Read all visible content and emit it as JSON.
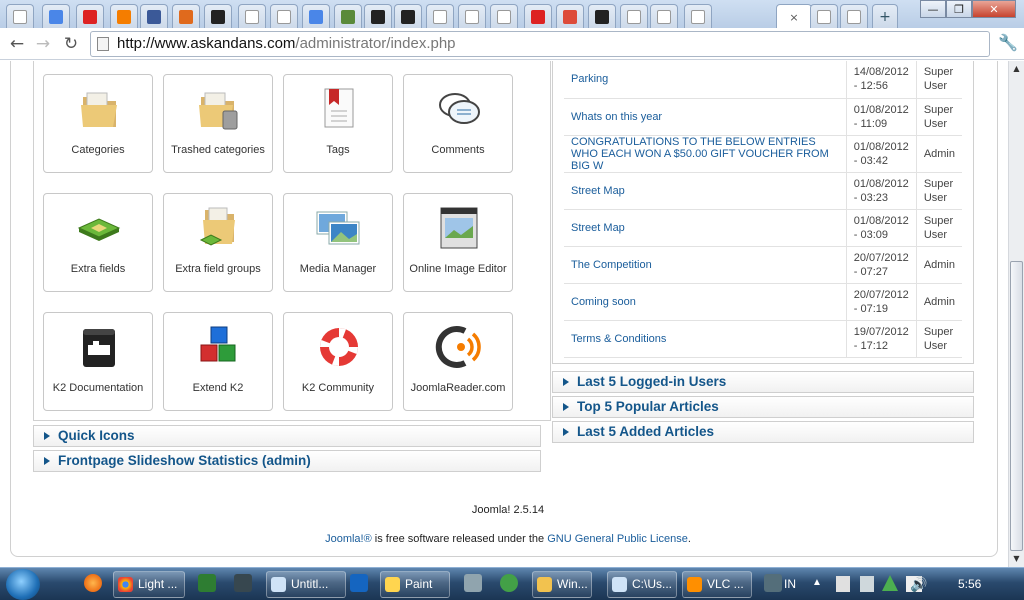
{
  "browser": {
    "url_host": "http://www.askandans.com",
    "url_path": "/administrator/index.php",
    "active_tab_close": "×"
  },
  "tabs": [
    {
      "icon": "page-icon",
      "color": "#ffffff"
    },
    {
      "icon": "google-icon",
      "color": "#4a86e8"
    },
    {
      "icon": "flag-icon",
      "color": "#d22"
    },
    {
      "icon": "blogger-icon",
      "color": "#f57d00"
    },
    {
      "icon": "facebook-icon",
      "color": "#3b5998"
    },
    {
      "icon": "joomla-icon",
      "color": "#e06a1d"
    },
    {
      "icon": "joomla-dark-icon",
      "color": "#222"
    },
    {
      "icon": "page-icon",
      "color": "#ffffff"
    },
    {
      "icon": "page-icon",
      "color": "#ffffff"
    },
    {
      "icon": "google-icon",
      "color": "#4a86e8"
    },
    {
      "icon": "map-icon",
      "color": "#5a8a3a"
    },
    {
      "icon": "joomla-dark-icon",
      "color": "#222"
    },
    {
      "icon": "joomla-dark-icon",
      "color": "#222"
    },
    {
      "icon": "mail-icon",
      "color": "#ffffff"
    },
    {
      "icon": "page-icon",
      "color": "#ffffff"
    },
    {
      "icon": "page-icon",
      "color": "#ffffff"
    },
    {
      "icon": "flag-icon",
      "color": "#d22"
    },
    {
      "icon": "gplus-icon",
      "color": "#dd4b39"
    },
    {
      "icon": "joomla-dark-icon",
      "color": "#222"
    },
    {
      "icon": "page-icon",
      "color": "#ffffff"
    },
    {
      "icon": "gmail-icon",
      "color": "#ffffff"
    },
    {
      "icon": "page-icon",
      "color": "#ffffff"
    }
  ],
  "icons": [
    {
      "label": "Categories",
      "icon": "folder-icon"
    },
    {
      "label": "Trashed categories",
      "icon": "trash-folder-icon"
    },
    {
      "label": "Tags",
      "icon": "tag-doc-icon"
    },
    {
      "label": "Comments",
      "icon": "comments-icon"
    },
    {
      "label": "Extra fields",
      "icon": "fields-icon"
    },
    {
      "label": "Extra field groups",
      "icon": "field-groups-icon"
    },
    {
      "label": "Media Manager",
      "icon": "media-icon"
    },
    {
      "label": "Online Image Editor",
      "icon": "image-editor-icon"
    },
    {
      "label": "K2 Documentation",
      "icon": "documentation-icon"
    },
    {
      "label": "Extend K2",
      "icon": "extend-icon"
    },
    {
      "label": "K2 Community",
      "icon": "lifebuoy-icon"
    },
    {
      "label": "JoomlaReader.com",
      "icon": "reader-icon"
    }
  ],
  "left_panes": [
    "Quick Icons",
    "Frontpage Slideshow Statistics (admin)"
  ],
  "right_panes": [
    "Last 5 Logged-in Users",
    "Top 5 Popular Articles",
    "Last 5 Added Articles"
  ],
  "articles": [
    {
      "title": "Parking",
      "date": "14/08/2012",
      "time": "- 12:56",
      "author": "Super User"
    },
    {
      "title": "Whats on this year",
      "date": "01/08/2012",
      "time": "- 11:09",
      "author": "Super User"
    },
    {
      "title": "CONGRATULATIONS TO THE BELOW ENTRIES WHO EACH WON A $50.00 GIFT VOUCHER FROM BIG W",
      "date": "01/08/2012",
      "time": "- 03:42",
      "author": "Admin"
    },
    {
      "title": "Street Map",
      "date": "01/08/2012",
      "time": "- 03:23",
      "author": "Super User"
    },
    {
      "title": "Street Map",
      "date": "01/08/2012",
      "time": "- 03:09",
      "author": "Super User"
    },
    {
      "title": "The Competition",
      "date": "20/07/2012",
      "time": "- 07:27",
      "author": "Admin"
    },
    {
      "title": "Coming soon",
      "date": "20/07/2012",
      "time": "- 07:19",
      "author": "Admin"
    },
    {
      "title": "Terms & Conditions",
      "date": "19/07/2012",
      "time": "- 17:12",
      "author": "Super User"
    }
  ],
  "footer": {
    "version": "Joomla! 2.5.14",
    "license_link1": "Joomla!®",
    "license_text": " is free software released under the ",
    "license_link2": "GNU General Public License",
    "license_end": "."
  },
  "taskbar": {
    "buttons": [
      {
        "label": "Light ...",
        "icon": "chrome-icon"
      },
      {
        "label": "Untitl...",
        "icon": "notepad-icon"
      },
      {
        "label": "Paint",
        "icon": "paint-icon"
      },
      {
        "label": "Win...",
        "icon": "folder-icon"
      },
      {
        "label": "C:\\Us...",
        "icon": "notepad-icon"
      },
      {
        "label": "VLC ...",
        "icon": "vlc-icon"
      }
    ],
    "lang": "IN",
    "clock": "5:56"
  }
}
